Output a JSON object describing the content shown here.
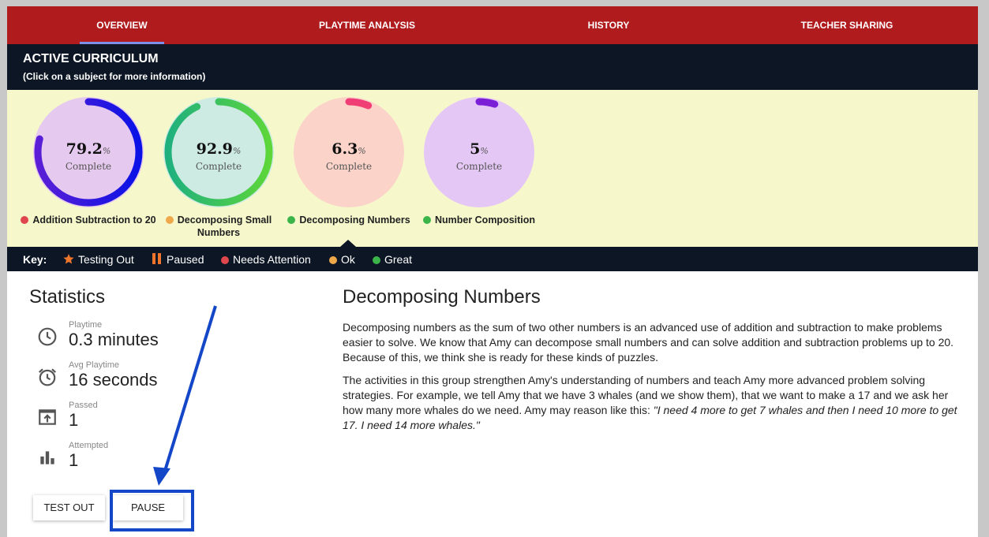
{
  "nav": {
    "tabs": [
      "OVERVIEW",
      "PLAYTIME ANALYSIS",
      "HISTORY",
      "TEACHER SHARING"
    ],
    "active": "OVERVIEW"
  },
  "curriculum": {
    "title": "ACTIVE CURRICULUM",
    "subtitle": "(Click on a subject for more information)",
    "complete_label": "Complete",
    "percent_sign": "%",
    "subjects": [
      {
        "label": "Addition Subtraction to 20",
        "percent": "79.2",
        "progress": 0.792,
        "status": "Needs Attention",
        "status_color": "#e0474c",
        "circle_color": "#e6c9ee",
        "ring_colors": [
          "#5a1fd6",
          "#0a12e6"
        ]
      },
      {
        "label": "Decomposing Small Numbers",
        "percent": "92.9",
        "progress": 0.929,
        "status": "Ok",
        "status_color": "#efa84a",
        "circle_color": "#cdebe3",
        "ring_colors": [
          "#1fb07e",
          "#5dd63a"
        ]
      },
      {
        "label": "Decomposing Numbers",
        "percent": "6.3",
        "progress": 0.063,
        "status": "Great",
        "status_color": "#3bb54a",
        "circle_color": "#fbd3c9",
        "ring_colors": [
          "#ff6a3d",
          "#f03d77"
        ]
      },
      {
        "label": "Number Composition",
        "percent": "5",
        "progress": 0.05,
        "status": "Great",
        "status_color": "#3bb54a",
        "circle_color": "#e5c7f6",
        "ring_colors": [
          "#b03df0",
          "#7a1fd6"
        ]
      }
    ]
  },
  "key": {
    "title": "Key:",
    "items": [
      {
        "label": "Testing Out",
        "icon": "star-icon",
        "color": "#f0762b"
      },
      {
        "label": "Paused",
        "icon": "pause-icon",
        "color": "#f0762b"
      },
      {
        "label": "Needs Attention",
        "icon": "dot-icon",
        "color": "#e0474c"
      },
      {
        "label": "Ok",
        "icon": "dot-icon",
        "color": "#efa84a"
      },
      {
        "label": "Great",
        "icon": "dot-icon",
        "color": "#3bb54a"
      }
    ]
  },
  "stats": {
    "title": "Statistics",
    "items": [
      {
        "label": "Playtime",
        "value": "0.3 minutes",
        "icon": "clock-icon"
      },
      {
        "label": "Avg Playtime",
        "value": "16 seconds",
        "icon": "alarm-clock-icon"
      },
      {
        "label": "Passed",
        "value": "1",
        "icon": "publish-icon"
      },
      {
        "label": "Attempted",
        "value": "1",
        "icon": "bar-chart-icon"
      }
    ],
    "buttons": {
      "test_out": "TEST OUT",
      "pause": "PAUSE"
    }
  },
  "detail": {
    "title": "Decomposing Numbers",
    "p1": "Decomposing numbers as the sum of two other numbers is an advanced use of addition and subtraction to make problems easier to solve. We know that Amy can decompose small numbers and can solve addition and subtraction problems up to 20. Because of this, we think she is ready for these kinds of puzzles.",
    "p2": "The activities in this group strengthen Amy's understanding of numbers and teach Amy more advanced problem solving strategies. For example, we tell Amy that we have 3 whales (and we show them), that we want to make a 17 and we ask her how many more whales do we need. Amy may reason like this: ",
    "p2_quote": "\"I need 4 more to get 7 whales and then I need 10 more to get 17. I need 14 more whales.\""
  },
  "annotation_color": "#1347c8"
}
